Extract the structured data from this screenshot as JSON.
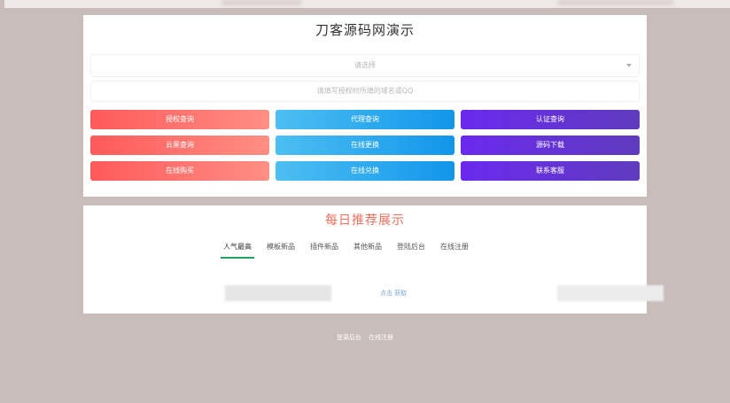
{
  "top": {
    "title": "刀客源码网演示",
    "select_placeholder": "请选择",
    "input_placeholder": "请填写授权时所填的域名或QQ",
    "buttons": [
      {
        "label": "授权查询",
        "color": "red"
      },
      {
        "label": "代理查询",
        "color": "blue"
      },
      {
        "label": "认证查询",
        "color": "purple"
      },
      {
        "label": "云黑查询",
        "color": "red"
      },
      {
        "label": "在线更换",
        "color": "blue"
      },
      {
        "label": "源码下载",
        "color": "purple"
      },
      {
        "label": "在线购买",
        "color": "red"
      },
      {
        "label": "在线兑换",
        "color": "blue"
      },
      {
        "label": "联系客服",
        "color": "purple"
      }
    ]
  },
  "recommend": {
    "title": "每日推荐展示",
    "tabs": [
      "人气最高",
      "模板新品",
      "插件新品",
      "其他新品",
      "登陆后台",
      "在线注册"
    ],
    "active_tab": "人气最高",
    "tip": "点击 获取"
  },
  "footer": {
    "links": [
      "登录后台",
      "在线注册"
    ]
  },
  "colors": {
    "background": "#c9bdbb",
    "red_button": "#ff5a5a",
    "blue_button": "#1296ea",
    "purple_button": "#6a2aee",
    "section_title": "#f06e5e",
    "active_tab_underline": "#21a366"
  }
}
